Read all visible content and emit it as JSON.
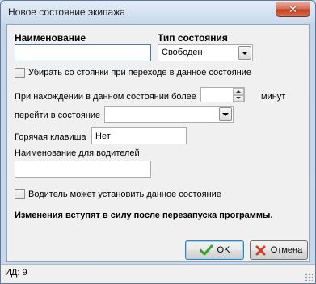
{
  "window": {
    "title": "Новое состояние экипажа",
    "close_symbol": "✕"
  },
  "form": {
    "name_label": "Наименование",
    "name_value": "",
    "state_type_label": "Тип состояния",
    "state_type_value": "Свободен",
    "remove_from_stand_label": "Убирать со стоянки при переходе в данное состояние",
    "remove_from_stand_checked": false,
    "duration_label": "При нахождении в данном состоянии более",
    "duration_value": "",
    "minutes_label": "минут",
    "goto_state_label": "перейти в состояние",
    "goto_state_value": "",
    "hotkey_label": "Горячая клавиша",
    "hotkey_value": "Нет",
    "driver_name_label": "Наименование для водителей",
    "driver_name_value": "",
    "driver_can_set_label": "Водитель может установить данное состояние",
    "driver_can_set_checked": false,
    "restart_notice": "Изменения вступят в силу после перезапуска программы."
  },
  "buttons": {
    "ok_label": "OK",
    "cancel_label": "Отмена"
  },
  "status": {
    "id_text": "ИД: 9"
  },
  "icons": {
    "ok": "check-icon",
    "cancel": "cross-icon",
    "ok_color": "#3aa12f",
    "cancel_color": "#d23a2a"
  }
}
